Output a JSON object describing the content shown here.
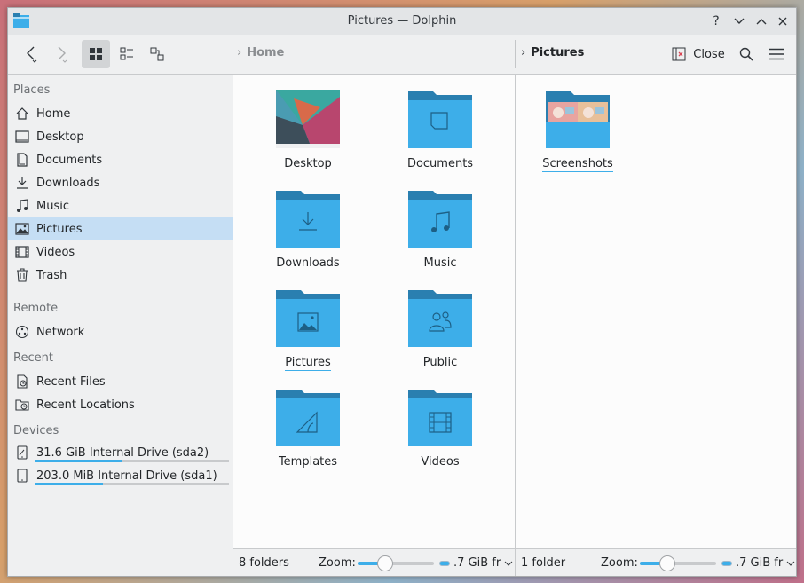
{
  "window": {
    "title": "Pictures — Dolphin",
    "help_glyph": "?",
    "minimize_glyph": "⌄",
    "maximize_glyph": "⌃",
    "close_glyph": "✕"
  },
  "toolbar": {
    "left_crumb": "Home",
    "right_crumb": "Pictures",
    "close_label": "Close"
  },
  "sidebar": {
    "sections": {
      "places": "Places",
      "remote": "Remote",
      "recent": "Recent",
      "devices": "Devices"
    },
    "places": [
      {
        "label": "Home",
        "icon": "home-icon"
      },
      {
        "label": "Desktop",
        "icon": "desktop-icon"
      },
      {
        "label": "Documents",
        "icon": "documents-icon"
      },
      {
        "label": "Downloads",
        "icon": "downloads-icon"
      },
      {
        "label": "Music",
        "icon": "music-icon"
      },
      {
        "label": "Pictures",
        "icon": "pictures-icon",
        "selected": true
      },
      {
        "label": "Videos",
        "icon": "videos-icon"
      },
      {
        "label": "Trash",
        "icon": "trash-icon"
      }
    ],
    "remote": [
      {
        "label": "Network",
        "icon": "network-icon"
      }
    ],
    "recent": [
      {
        "label": "Recent Files",
        "icon": "recent-files-icon"
      },
      {
        "label": "Recent Locations",
        "icon": "recent-locations-icon"
      }
    ],
    "devices": [
      {
        "label": "31.6 GiB Internal Drive (sda2)",
        "usage": 0.45
      },
      {
        "label": "203.0 MiB Internal Drive (sda1)",
        "usage": 0.35
      }
    ]
  },
  "left_pane": {
    "items": [
      {
        "label": "Desktop",
        "icon": "desktop-wallpaper-thumbnail"
      },
      {
        "label": "Documents",
        "icon": "folder-documents-icon"
      },
      {
        "label": "Downloads",
        "icon": "folder-downloads-icon"
      },
      {
        "label": "Music",
        "icon": "folder-music-icon"
      },
      {
        "label": "Pictures",
        "icon": "folder-pictures-icon"
      },
      {
        "label": "Public",
        "icon": "folder-public-icon"
      },
      {
        "label": "Templates",
        "icon": "folder-templates-icon"
      },
      {
        "label": "Videos",
        "icon": "folder-videos-icon"
      }
    ],
    "status_count": "8 folders",
    "zoom_label": "Zoom:",
    "free_space": ".7 GiB fr"
  },
  "right_pane": {
    "items": [
      {
        "label": "Screenshots",
        "icon": "folder-screenshots-icon"
      }
    ],
    "status_count": "1 folder",
    "zoom_label": "Zoom:",
    "free_space": ".7 GiB fr"
  },
  "colors": {
    "accent": "#3daee9",
    "folder_body": "#3daee9",
    "folder_tab": "#2a7fb0",
    "selection": "#c5def4"
  }
}
